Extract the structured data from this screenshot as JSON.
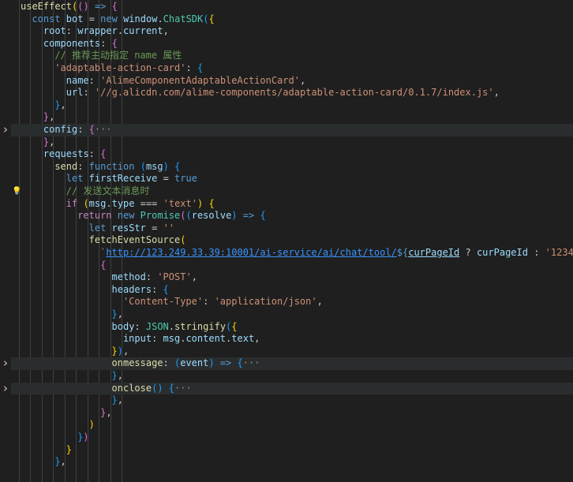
{
  "editor": {
    "colors": {
      "background": "#1f1f1f",
      "keyword_control": "#c586c0",
      "keyword": "#569cd6",
      "function": "#dcdcaa",
      "variable": "#9cdcfe",
      "string": "#ce9178",
      "comment": "#6a9955",
      "class": "#4ec9b0",
      "punctuation": "#cccccc",
      "bracket_yellow": "#ffd700",
      "bracket_pink": "#da70d6",
      "bracket_blue": "#179fff",
      "link": "#3794ff",
      "fold_ellipsis": "#8c8c8c"
    },
    "lines": [
      {
        "indent": 0,
        "tokens": [
          [
            "useEffect",
            "function"
          ],
          [
            "(",
            "bracket_yellow"
          ],
          [
            "()",
            "bracket_pink"
          ],
          [
            " => ",
            "keyword"
          ],
          [
            "{",
            "bracket_pink"
          ]
        ]
      },
      {
        "indent": 1,
        "tokens": [
          [
            "const ",
            "keyword"
          ],
          [
            "bot",
            "variable"
          ],
          [
            " = ",
            "punctuation"
          ],
          [
            "new ",
            "keyword"
          ],
          [
            "window",
            "variable"
          ],
          [
            ".",
            "punctuation"
          ],
          [
            "ChatSDK",
            "class"
          ],
          [
            "(",
            "bracket_blue"
          ],
          [
            "{",
            "bracket_yellow"
          ]
        ]
      },
      {
        "indent": 2,
        "tokens": [
          [
            "root",
            "variable"
          ],
          [
            ": ",
            "punctuation"
          ],
          [
            "wrapper",
            "variable"
          ],
          [
            ".",
            "punctuation"
          ],
          [
            "current",
            "variable"
          ],
          [
            ",",
            "punctuation"
          ]
        ]
      },
      {
        "indent": 2,
        "tokens": [
          [
            "components",
            "variable"
          ],
          [
            ": ",
            "punctuation"
          ],
          [
            "{",
            "bracket_pink"
          ]
        ]
      },
      {
        "indent": 3,
        "tokens": [
          [
            "// 推荐主动指定 name 属性",
            "comment"
          ]
        ]
      },
      {
        "indent": 3,
        "tokens": [
          [
            "'adaptable-action-card'",
            "string"
          ],
          [
            ": ",
            "punctuation"
          ],
          [
            "{",
            "bracket_blue"
          ]
        ]
      },
      {
        "indent": 4,
        "tokens": [
          [
            "name",
            "variable"
          ],
          [
            ": ",
            "punctuation"
          ],
          [
            "'AlimeComponentAdaptableActionCard'",
            "string"
          ],
          [
            ",",
            "punctuation"
          ]
        ]
      },
      {
        "indent": 4,
        "tokens": [
          [
            "url",
            "variable"
          ],
          [
            ": ",
            "punctuation"
          ],
          [
            "'//g.alicdn.com/alime-components/adaptable-action-card/0.1.7/index.js'",
            "string"
          ],
          [
            ",",
            "punctuation"
          ]
        ]
      },
      {
        "indent": 3,
        "tokens": [
          [
            "}",
            "bracket_blue"
          ],
          [
            ",",
            "punctuation"
          ]
        ]
      },
      {
        "indent": 2,
        "tokens": [
          [
            "}",
            "bracket_pink"
          ],
          [
            ",",
            "punctuation"
          ]
        ]
      },
      {
        "indent": 2,
        "folded": true,
        "tokens": [
          [
            "config",
            "variable"
          ],
          [
            ": ",
            "punctuation"
          ],
          [
            "{",
            "bracket_pink"
          ],
          [
            "···",
            "fold_ellipsis"
          ]
        ]
      },
      {
        "indent": 2,
        "tokens": [
          [
            "}",
            "bracket_pink"
          ],
          [
            ",",
            "punctuation"
          ]
        ]
      },
      {
        "indent": 2,
        "tokens": [
          [
            "requests",
            "variable"
          ],
          [
            ": ",
            "punctuation"
          ],
          [
            "{",
            "bracket_pink"
          ]
        ]
      },
      {
        "indent": 3,
        "tokens": [
          [
            "send",
            "function"
          ],
          [
            ": ",
            "punctuation"
          ],
          [
            "function ",
            "keyword"
          ],
          [
            "(",
            "bracket_blue"
          ],
          [
            "msg",
            "variable"
          ],
          [
            ")",
            "bracket_blue"
          ],
          [
            " ",
            "punctuation"
          ],
          [
            "{",
            "bracket_blue"
          ]
        ]
      },
      {
        "indent": 4,
        "tokens": [
          [
            "let ",
            "keyword"
          ],
          [
            "firstReceive",
            "variable"
          ],
          [
            " = ",
            "punctuation"
          ],
          [
            "true",
            "keyword"
          ]
        ]
      },
      {
        "indent": 4,
        "bulb": true,
        "tokens": [
          [
            "// 发送文本消息时",
            "comment"
          ]
        ]
      },
      {
        "indent": 4,
        "tokens": [
          [
            "if ",
            "keyword_control"
          ],
          [
            "(",
            "bracket_yellow"
          ],
          [
            "msg",
            "variable"
          ],
          [
            ".",
            "punctuation"
          ],
          [
            "type",
            "variable"
          ],
          [
            " === ",
            "punctuation"
          ],
          [
            "'text'",
            "string"
          ],
          [
            ")",
            "bracket_yellow"
          ],
          [
            " ",
            "punctuation"
          ],
          [
            "{",
            "bracket_yellow"
          ]
        ]
      },
      {
        "indent": 5,
        "tokens": [
          [
            "return ",
            "keyword_control"
          ],
          [
            "new ",
            "keyword"
          ],
          [
            "Promise",
            "class"
          ],
          [
            "(",
            "bracket_pink"
          ],
          [
            "(",
            "bracket_blue"
          ],
          [
            "resolve",
            "variable"
          ],
          [
            ")",
            "bracket_blue"
          ],
          [
            " => ",
            "keyword"
          ],
          [
            "{",
            "bracket_blue"
          ]
        ]
      },
      {
        "indent": 6,
        "tokens": [
          [
            "let ",
            "keyword"
          ],
          [
            "resStr",
            "variable"
          ],
          [
            " = ",
            "punctuation"
          ],
          [
            "''",
            "string"
          ]
        ]
      },
      {
        "indent": 6,
        "tokens": [
          [
            "fetchEventSource",
            "function"
          ],
          [
            "(",
            "bracket_yellow"
          ]
        ]
      },
      {
        "indent": 7,
        "tokens": [
          [
            "`",
            "string"
          ],
          [
            "http://123.249.33.39:10001/ai-service/ai/chat/tool/",
            "link"
          ],
          [
            "${",
            "keyword"
          ],
          [
            "curPageId",
            "variable"
          ],
          [
            " ? ",
            "punctuation"
          ],
          [
            "curPageId",
            "variable"
          ],
          [
            " : ",
            "punctuation"
          ],
          [
            "'1234'",
            "string"
          ],
          [
            "}",
            "keyword"
          ],
          [
            "`",
            "string"
          ],
          [
            ",",
            "punctuation"
          ]
        ]
      },
      {
        "indent": 7,
        "tokens": [
          [
            "{",
            "bracket_pink"
          ]
        ]
      },
      {
        "indent": 8,
        "tokens": [
          [
            "method",
            "variable"
          ],
          [
            ": ",
            "punctuation"
          ],
          [
            "'POST'",
            "string"
          ],
          [
            ",",
            "punctuation"
          ]
        ]
      },
      {
        "indent": 8,
        "tokens": [
          [
            "headers",
            "variable"
          ],
          [
            ": ",
            "punctuation"
          ],
          [
            "{",
            "bracket_blue"
          ]
        ]
      },
      {
        "indent": 9,
        "tokens": [
          [
            "'Content-Type'",
            "string"
          ],
          [
            ": ",
            "punctuation"
          ],
          [
            "'application/json'",
            "string"
          ],
          [
            ",",
            "punctuation"
          ]
        ]
      },
      {
        "indent": 8,
        "tokens": [
          [
            "}",
            "bracket_blue"
          ],
          [
            ",",
            "punctuation"
          ]
        ]
      },
      {
        "indent": 8,
        "tokens": [
          [
            "body",
            "variable"
          ],
          [
            ": ",
            "punctuation"
          ],
          [
            "JSON",
            "class"
          ],
          [
            ".",
            "punctuation"
          ],
          [
            "stringify",
            "function"
          ],
          [
            "(",
            "bracket_blue"
          ],
          [
            "{",
            "bracket_yellow"
          ]
        ]
      },
      {
        "indent": 9,
        "tokens": [
          [
            "input",
            "variable"
          ],
          [
            ": ",
            "punctuation"
          ],
          [
            "msg",
            "variable"
          ],
          [
            ".",
            "punctuation"
          ],
          [
            "content",
            "variable"
          ],
          [
            ".",
            "punctuation"
          ],
          [
            "text",
            "variable"
          ],
          [
            ",",
            "punctuation"
          ]
        ]
      },
      {
        "indent": 8,
        "tokens": [
          [
            "}",
            "bracket_yellow"
          ],
          [
            ")",
            "bracket_blue"
          ],
          [
            ",",
            "punctuation"
          ]
        ]
      },
      {
        "indent": 8,
        "folded": true,
        "tokens": [
          [
            "onmessage",
            "function"
          ],
          [
            ": ",
            "punctuation"
          ],
          [
            "(",
            "bracket_blue"
          ],
          [
            "event",
            "variable"
          ],
          [
            ")",
            "bracket_blue"
          ],
          [
            " => ",
            "keyword"
          ],
          [
            "{",
            "bracket_blue"
          ],
          [
            "···",
            "fold_ellipsis"
          ]
        ]
      },
      {
        "indent": 8,
        "tokens": [
          [
            "}",
            "bracket_blue"
          ],
          [
            ",",
            "punctuation"
          ]
        ]
      },
      {
        "indent": 8,
        "folded": true,
        "tokens": [
          [
            "onclose",
            "function"
          ],
          [
            "()",
            "bracket_blue"
          ],
          [
            " ",
            "punctuation"
          ],
          [
            "{",
            "bracket_blue"
          ],
          [
            "···",
            "fold_ellipsis"
          ]
        ]
      },
      {
        "indent": 8,
        "tokens": [
          [
            "}",
            "bracket_blue"
          ],
          [
            ",",
            "punctuation"
          ]
        ]
      },
      {
        "indent": 7,
        "tokens": [
          [
            "}",
            "bracket_pink"
          ],
          [
            ",",
            "punctuation"
          ]
        ]
      },
      {
        "indent": 6,
        "tokens": [
          [
            ")",
            "bracket_yellow"
          ]
        ]
      },
      {
        "indent": 5,
        "tokens": [
          [
            "}",
            "bracket_blue"
          ],
          [
            ")",
            "bracket_pink"
          ]
        ]
      },
      {
        "indent": 4,
        "tokens": [
          [
            "}",
            "bracket_yellow"
          ]
        ]
      },
      {
        "indent": 3,
        "tokens": [
          [
            "}",
            "bracket_blue"
          ],
          [
            ",",
            "punctuation"
          ]
        ]
      }
    ]
  }
}
